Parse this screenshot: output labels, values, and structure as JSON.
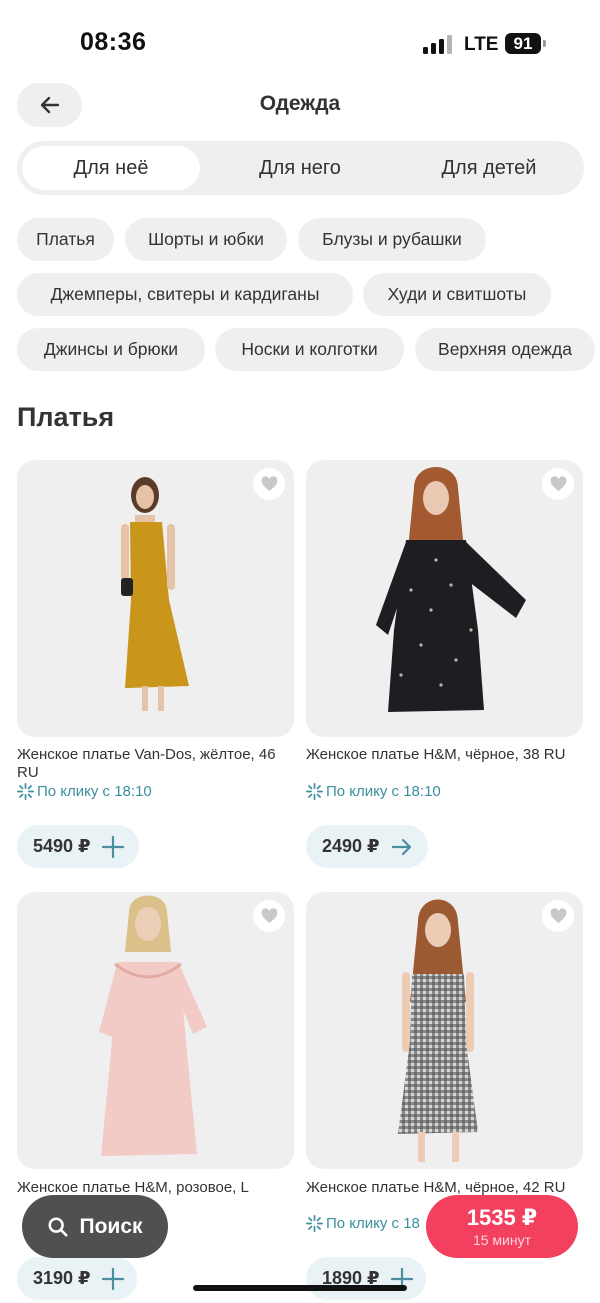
{
  "status": {
    "time": "08:36",
    "network": "LTE",
    "battery": "91"
  },
  "header": {
    "title": "Одежда",
    "back_icon": "arrow-left-icon"
  },
  "segments": [
    {
      "label": "Для неё",
      "active": true
    },
    {
      "label": "Для него",
      "active": false
    },
    {
      "label": "Для детей",
      "active": false
    }
  ],
  "categories": [
    "Платья",
    "Шорты и юбки",
    "Блузы и рубашки",
    "Джемперы, свитеры и кардиганы",
    "Худи и свитшоты",
    "Джинсы и брюки",
    "Носки и колготки",
    "Верхняя одежда"
  ],
  "section": {
    "title": "Платья"
  },
  "products": [
    {
      "title": "Женское платье Van-Dos, жёлтое, 46 RU",
      "promo": "По клику с 18:10",
      "price": "5490 ₽",
      "action_icon": "plus-icon",
      "dress_color": "#c9951a"
    },
    {
      "title": "Женское платье H&M, чёрное, 38 RU",
      "promo": "По клику с 18:10",
      "price": "2490 ₽",
      "action_icon": "arrow-right-icon",
      "dress_color": "#1e1e22"
    },
    {
      "title": "Женское платье H&M, розовое, L",
      "promo": "",
      "price": "3190 ₽",
      "action_icon": "plus-icon",
      "dress_color": "#f2cbc6"
    },
    {
      "title": "Женское платье H&M, чёрное, 42 RU",
      "promo": "По клику с 18",
      "price": "1890 ₽",
      "action_icon": "plus-icon",
      "dress_color": "#4a4a4a"
    }
  ],
  "search_button": {
    "label": "Поиск"
  },
  "cart": {
    "price": "1535 ₽",
    "eta": "15 минут"
  },
  "colors": {
    "accent": "#f2405e",
    "promo": "#3b8fa0",
    "chip": "#efefef",
    "price_pill": "#e9f2f5"
  }
}
